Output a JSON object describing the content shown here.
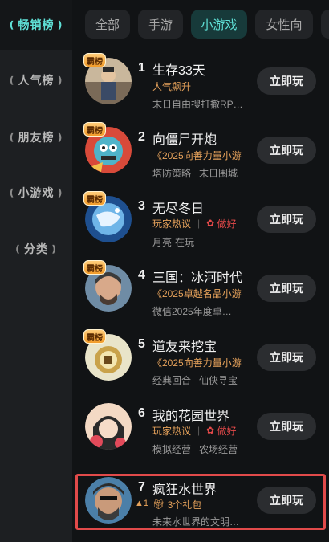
{
  "sidebar": {
    "items": [
      {
        "label": "畅销榜",
        "active": true
      },
      {
        "label": "人气榜",
        "active": false
      },
      {
        "label": "朋友榜",
        "active": false
      },
      {
        "label": "小游戏",
        "active": false
      },
      {
        "label": "分类",
        "active": false
      }
    ]
  },
  "tabs": [
    {
      "label": "全部",
      "active": false
    },
    {
      "label": "手游",
      "active": false
    },
    {
      "label": "小游戏",
      "active": true
    },
    {
      "label": "女性向",
      "active": false
    }
  ],
  "colors": {
    "accent": "#5fe0d6",
    "tag": "#e6a25b",
    "highlight": "#e14a4a"
  },
  "games": [
    {
      "rank": "1",
      "title": "生存33天",
      "badge": "霸榜",
      "tag": "人气飙升",
      "sub": "末日自由搜打撤RP…",
      "button": "立即玩",
      "icon": "survivor-avatar"
    },
    {
      "rank": "2",
      "title": "向僵尸开炮",
      "badge": "霸榜",
      "tag": "《2025向善力量小游",
      "sub1": "塔防策略",
      "sub2": "末日围城",
      "button": "立即玩",
      "icon": "zombie-avatar"
    },
    {
      "rank": "3",
      "title": "无尽冬日",
      "badge": "霸榜",
      "hot": "玩家热议",
      "good": "做好",
      "sub1": "月亮",
      "sub2": "在玩",
      "button": "立即玩",
      "icon": "frozen-planet-avatar"
    },
    {
      "rank": "4",
      "title": "三国：冰河时代",
      "badge": "霸榜",
      "tag": "《2025卓越名品小游",
      "sub": "微信2025年度卓…",
      "button": "立即玩",
      "icon": "warrior-avatar"
    },
    {
      "rank": "5",
      "title": "道友来挖宝",
      "badge": "霸榜",
      "tag": "《2025向善力量小游",
      "sub1": "经典回合",
      "sub2": "仙侠寻宝",
      "button": "立即玩",
      "icon": "treasure-avatar"
    },
    {
      "rank": "6",
      "title": "我的花园世界",
      "hot": "玩家热议",
      "good": "做好",
      "sub1": "模拟经营",
      "sub2": "农场经营",
      "button": "立即玩",
      "icon": "garden-girl-avatar"
    },
    {
      "rank": "7",
      "title": "疯狂水世界",
      "up": "▲1",
      "gift": "3个礼包",
      "sub": "未来水世界的文明…",
      "button": "立即玩",
      "icon": "pirate-avatar"
    }
  ]
}
